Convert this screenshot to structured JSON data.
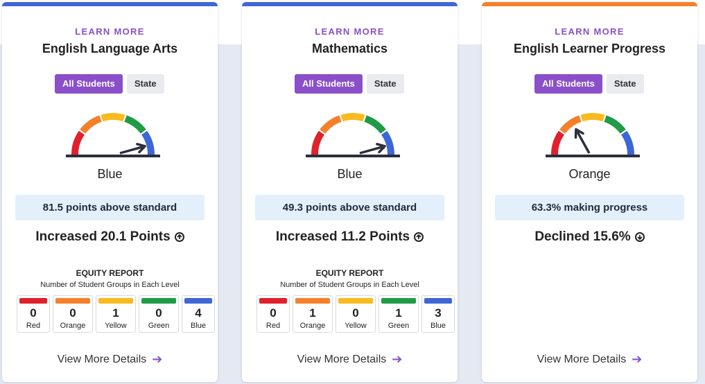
{
  "colors": {
    "accent": "#8a4fc9",
    "red": "#e0202b",
    "orange": "#f5802a",
    "yellow": "#f8bb1f",
    "green": "#1f9b48",
    "blue": "#3f66d6"
  },
  "cards": [
    {
      "topbar_color": "#3f66d6",
      "learn_more": "LEARN MORE",
      "title": "English Language Arts",
      "toggle": {
        "all": "All Students",
        "state": "State"
      },
      "gauge_level": 5,
      "status": "Blue",
      "pill": "81.5 points above standard",
      "change": "Increased 20.1 Points",
      "change_icon": "arrow-up-circle-icon",
      "equity": {
        "title": "EQUITY REPORT",
        "subtitle": "Number of Student Groups in Each Level",
        "levels": [
          {
            "label": "Red",
            "count": "0"
          },
          {
            "label": "Orange",
            "count": "0"
          },
          {
            "label": "Yellow",
            "count": "1"
          },
          {
            "label": "Green",
            "count": "0"
          },
          {
            "label": "Blue",
            "count": "4"
          }
        ]
      },
      "details": "View More Details"
    },
    {
      "topbar_color": "#3f66d6",
      "learn_more": "LEARN MORE",
      "title": "Mathematics",
      "toggle": {
        "all": "All Students",
        "state": "State"
      },
      "gauge_level": 5,
      "status": "Blue",
      "pill": "49.3 points above standard",
      "change": "Increased 11.2 Points",
      "change_icon": "arrow-up-circle-icon",
      "equity": {
        "title": "EQUITY REPORT",
        "subtitle": "Number of Student Groups in Each Level",
        "levels": [
          {
            "label": "Red",
            "count": "0"
          },
          {
            "label": "Orange",
            "count": "1"
          },
          {
            "label": "Yellow",
            "count": "0"
          },
          {
            "label": "Green",
            "count": "1"
          },
          {
            "label": "Blue",
            "count": "3"
          }
        ]
      },
      "details": "View More Details"
    },
    {
      "topbar_color": "#f5802a",
      "learn_more": "LEARN MORE",
      "title": "English Learner Progress",
      "toggle": {
        "all": "All Students",
        "state": "State"
      },
      "gauge_level": 2,
      "status": "Orange",
      "pill": "63.3% making progress",
      "change": "Declined 15.6%",
      "change_icon": "arrow-down-circle-icon",
      "details": "View More Details"
    }
  ]
}
